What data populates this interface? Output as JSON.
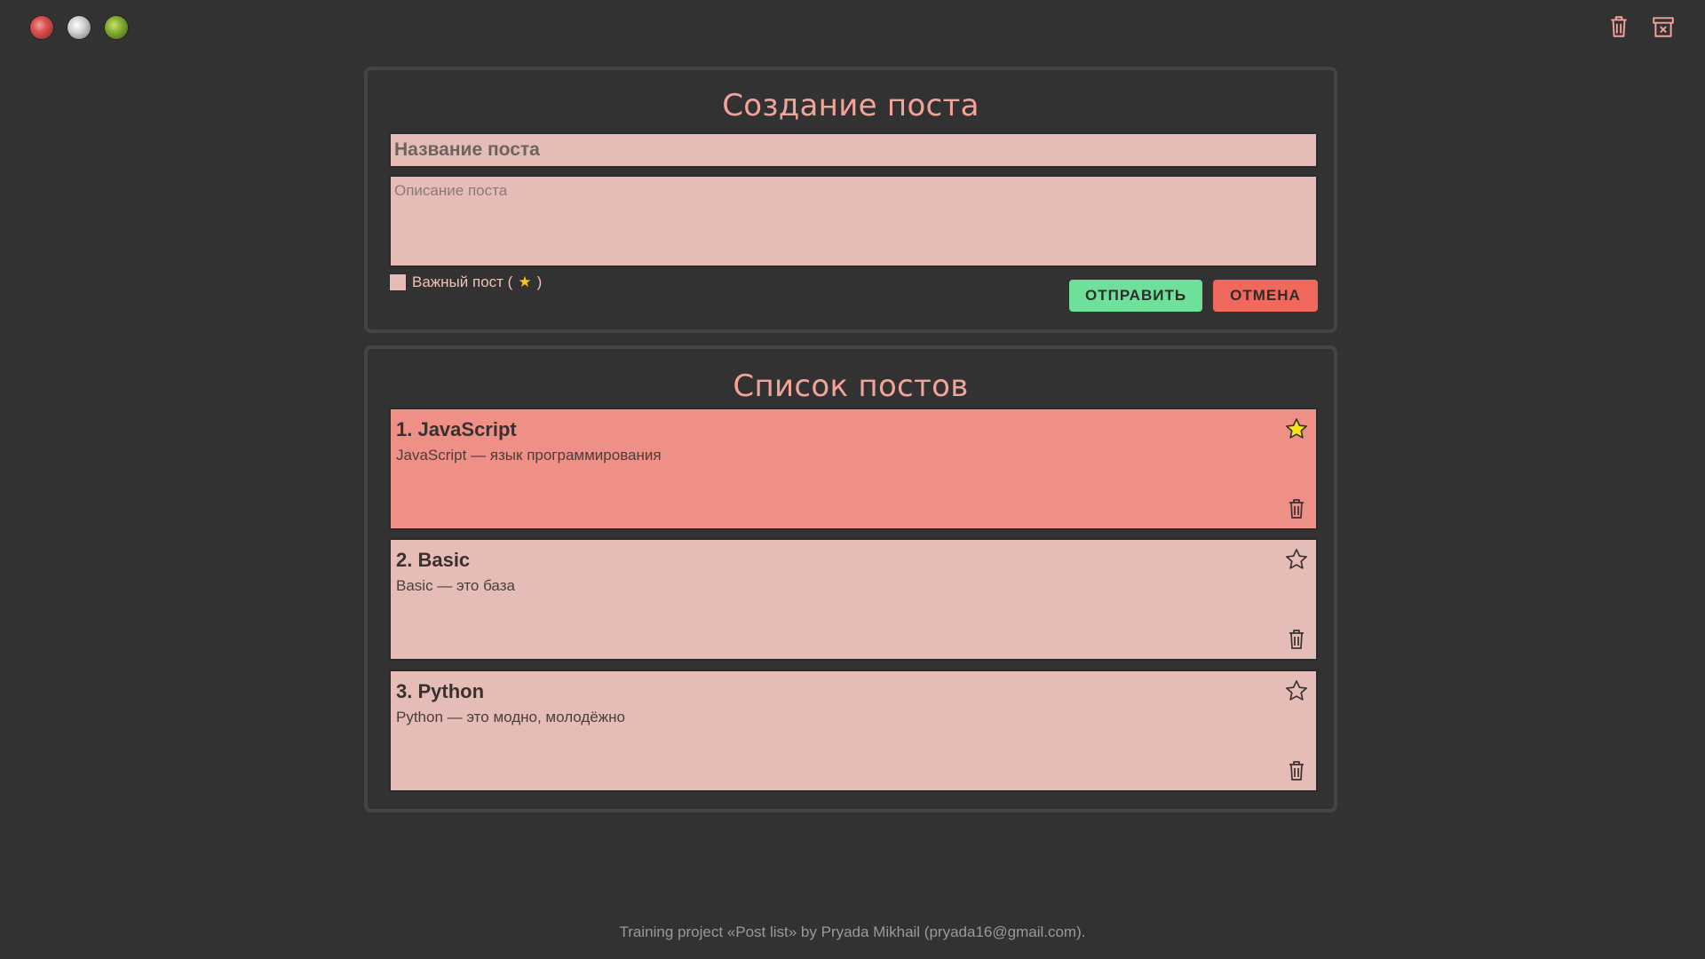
{
  "create": {
    "heading": "Создание поста",
    "title_placeholder": "Название поста",
    "desc_placeholder": "Описание поста",
    "important_label": "Важный пост (",
    "important_star": "★",
    "important_close": ")",
    "send_label": "ОТПРАВИТЬ",
    "cancel_label": "ОТМЕНА"
  },
  "list": {
    "heading": "Список постов",
    "posts": [
      {
        "title": "1. JavaScript",
        "desc": "JavaScript — язык программирования",
        "important": true
      },
      {
        "title": "2. Basic",
        "desc": "Basic — это база",
        "important": false
      },
      {
        "title": "3. Python",
        "desc": "Python — это модно, молодёжно",
        "important": false
      }
    ]
  },
  "footer": "Training project «Post list» by Pryada Mikhail (pryada16@gmail.com).",
  "colors": {
    "accent": "#f4a399",
    "send": "#6fe09a",
    "cancel": "#f0695c",
    "star_active": "#f5e51b"
  }
}
